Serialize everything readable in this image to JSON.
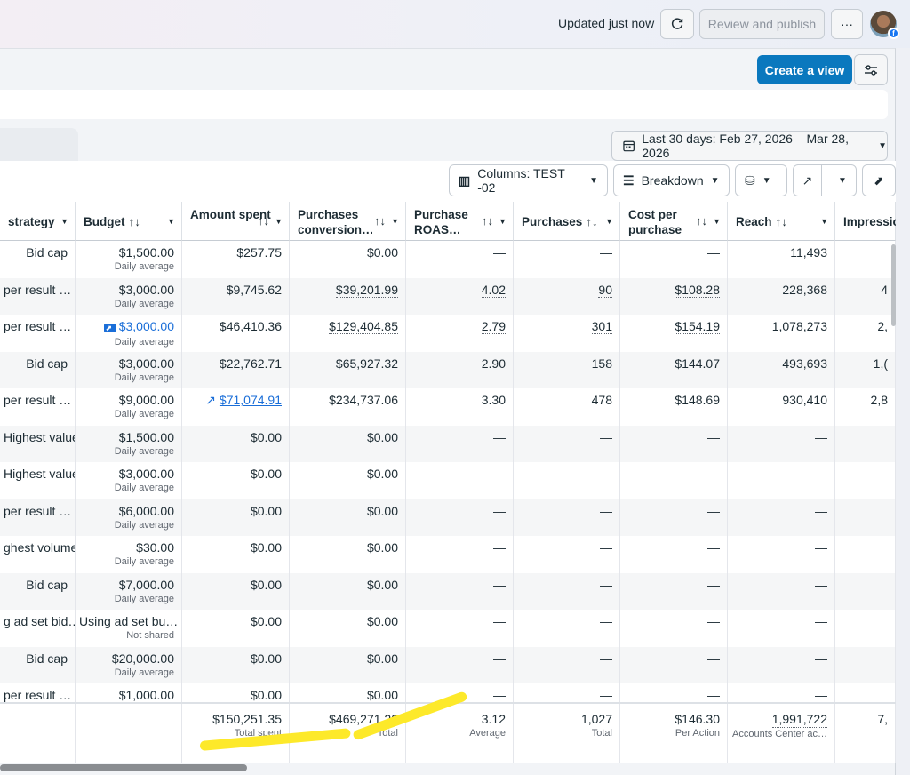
{
  "header": {
    "updated": "Updated just now",
    "review_publish": "Review and publish",
    "more": "···"
  },
  "create_view": "Create a view",
  "date_range": "Last 30 days: Feb 27, 2026 – Mar 28, 2026",
  "toolbar": {
    "columns": "Columns: TEST -02",
    "breakdown": "Breakdown"
  },
  "columns": [
    {
      "label": "strategy",
      "sort": ""
    },
    {
      "label": "Budget",
      "sort": "↑↓"
    },
    {
      "label": "Amount spent",
      "sort": "↑↓"
    },
    {
      "label": "Purchases conversion…",
      "sort": "↑↓"
    },
    {
      "label": "Purchase ROAS…",
      "sort": "↑↓"
    },
    {
      "label": "Purchases",
      "sort": "↑↓"
    },
    {
      "label": "Cost per purchase",
      "sort": "↑↓"
    },
    {
      "label": "Reach",
      "sort": "↑↓"
    },
    {
      "label": "Impressio…",
      "sort": ""
    }
  ],
  "rows": [
    {
      "strategy": "Bid cap",
      "budget": "$1,500.00",
      "budget_sub": "Daily average",
      "spent": "$257.75",
      "conv": "$0.00",
      "roas": "—",
      "purchases": "—",
      "cpp": "—",
      "reach": "11,493",
      "impr": ""
    },
    {
      "strategy": "per result …",
      "budget": "$3,000.00",
      "budget_sub": "Daily average",
      "spent": "$9,745.62",
      "conv": "$39,201.99",
      "roas": "4.02",
      "purchases": "90",
      "cpp": "$108.28",
      "reach": "228,368",
      "impr": "4"
    },
    {
      "strategy": "per result …",
      "budget": "$3,000.00",
      "budget_sub": "Daily average",
      "spent": "$46,410.36",
      "conv": "$129,404.85",
      "roas": "2.79",
      "purchases": "301",
      "cpp": "$154.19",
      "reach": "1,078,273",
      "impr": "2,"
    },
    {
      "strategy": "Bid cap",
      "budget": "$3,000.00",
      "budget_sub": "Daily average",
      "spent": "$22,762.71",
      "conv": "$65,927.32",
      "roas": "2.90",
      "purchases": "158",
      "cpp": "$144.07",
      "reach": "493,693",
      "impr": "1,("
    },
    {
      "strategy": "per result …",
      "budget": "$9,000.00",
      "budget_sub": "Daily average",
      "spent": "$71,074.91",
      "conv": "$234,737.06",
      "roas": "3.30",
      "purchases": "478",
      "cpp": "$148.69",
      "reach": "930,410",
      "impr": "2,8"
    },
    {
      "strategy": "Highest value",
      "budget": "$1,500.00",
      "budget_sub": "Daily average",
      "spent": "$0.00",
      "conv": "$0.00",
      "roas": "—",
      "purchases": "—",
      "cpp": "—",
      "reach": "—",
      "impr": ""
    },
    {
      "strategy": "Highest value",
      "budget": "$3,000.00",
      "budget_sub": "Daily average",
      "spent": "$0.00",
      "conv": "$0.00",
      "roas": "—",
      "purchases": "—",
      "cpp": "—",
      "reach": "—",
      "impr": ""
    },
    {
      "strategy": "per result …",
      "budget": "$6,000.00",
      "budget_sub": "Daily average",
      "spent": "$0.00",
      "conv": "$0.00",
      "roas": "—",
      "purchases": "—",
      "cpp": "—",
      "reach": "—",
      "impr": ""
    },
    {
      "strategy": "ghest volume",
      "budget": "$30.00",
      "budget_sub": "Daily average",
      "spent": "$0.00",
      "conv": "$0.00",
      "roas": "—",
      "purchases": "—",
      "cpp": "—",
      "reach": "—",
      "impr": ""
    },
    {
      "strategy": "Bid cap",
      "budget": "$7,000.00",
      "budget_sub": "Daily average",
      "spent": "$0.00",
      "conv": "$0.00",
      "roas": "—",
      "purchases": "—",
      "cpp": "—",
      "reach": "—",
      "impr": ""
    },
    {
      "strategy": "g ad set bid…",
      "budget": "Using ad set bu…",
      "budget_sub": "Not shared",
      "spent": "$0.00",
      "conv": "$0.00",
      "roas": "—",
      "purchases": "—",
      "cpp": "—",
      "reach": "—",
      "impr": ""
    },
    {
      "strategy": "Bid cap",
      "budget": "$20,000.00",
      "budget_sub": "Daily average",
      "spent": "$0.00",
      "conv": "$0.00",
      "roas": "—",
      "purchases": "—",
      "cpp": "—",
      "reach": "—",
      "impr": ""
    },
    {
      "strategy": "per result …",
      "budget": "$1,000.00",
      "budget_sub": "",
      "spent": "$0.00",
      "conv": "$0.00",
      "roas": "—",
      "purchases": "—",
      "cpp": "—",
      "reach": "—",
      "impr": ""
    }
  ],
  "totals": {
    "spent": "$150,251.35",
    "spent_sub": "Total spent",
    "conv": "$469,271.22",
    "conv_sub": "Total",
    "roas": "3.12",
    "roas_sub": "Average",
    "purchases": "1,027",
    "purchases_sub": "Total",
    "cpp": "$146.30",
    "cpp_sub": "Per Action",
    "reach": "1,991,722",
    "reach_sub": "Accounts Center ac…",
    "impr": "7,"
  },
  "colors": {
    "primary": "#0a78be",
    "highlight": "#fde92a",
    "link": "#1a6ed8"
  }
}
